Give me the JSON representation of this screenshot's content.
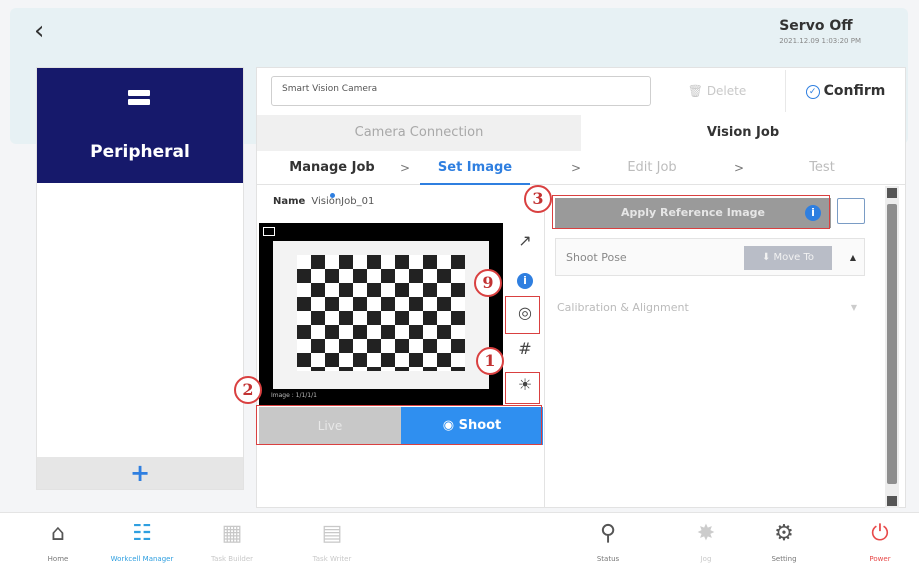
{
  "header": {
    "back_glyph": "‹",
    "servo_status": "Servo Off",
    "timestamp": "2021.12.09 1:03:20 PM"
  },
  "sidebar": {
    "title": "Peripheral",
    "add_label": "+"
  },
  "toolbar": {
    "name_value": "Smart Vision Camera",
    "delete_label": "Delete",
    "confirm_label": "Confirm"
  },
  "tabs": [
    {
      "label": "Camera Connection",
      "active": false
    },
    {
      "label": "Vision Job",
      "active": true
    }
  ],
  "steps": [
    {
      "label": "Manage Job",
      "state": "done"
    },
    {
      "label": "Set Image",
      "state": "active"
    },
    {
      "label": "Edit Job",
      "state": "disabled"
    },
    {
      "label": "Test",
      "state": "disabled"
    }
  ],
  "step_separator": ">",
  "left": {
    "name_label": "Name",
    "name_value": "VisionJob_01",
    "preview_footer": "Image : 1/1/1/1",
    "live_label": "Live",
    "shoot_label": "Shoot"
  },
  "right": {
    "apply_label": "Apply Reference Image",
    "shoot_pose_label": "Shoot Pose",
    "move_to_label": "Move To",
    "calibration_label": "Calibration & Alignment"
  },
  "callouts": [
    "1",
    "2",
    "3",
    "9"
  ],
  "bottom_nav": [
    {
      "label": "Home",
      "icon": "home-icon",
      "state": "normal"
    },
    {
      "label": "Workcell Manager",
      "icon": "workcell-icon",
      "state": "active"
    },
    {
      "label": "Task Builder",
      "icon": "task-builder-icon",
      "state": "disabled"
    },
    {
      "label": "Task Writer",
      "icon": "task-writer-icon",
      "state": "disabled"
    },
    {
      "label": "Status",
      "icon": "status-icon",
      "state": "normal"
    },
    {
      "label": "Jog",
      "icon": "jog-icon",
      "state": "disabled"
    },
    {
      "label": "Setting",
      "icon": "gear-icon",
      "state": "normal"
    },
    {
      "label": "Power",
      "icon": "power-icon",
      "state": "alert"
    }
  ],
  "colors": {
    "accent": "#2f7fe0",
    "sidebar_active": "#16196b",
    "callout": "#d94040",
    "power": "#e84a4a"
  }
}
